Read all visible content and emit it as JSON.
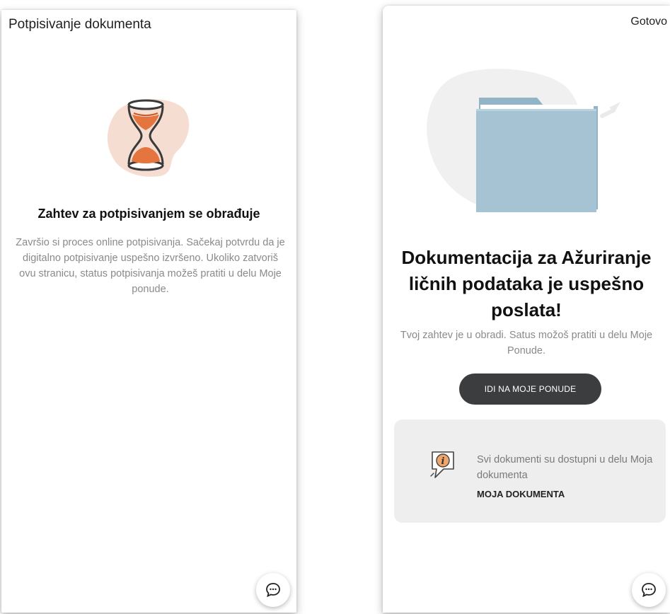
{
  "left_screen": {
    "title": "Potpisivanje dokumenta",
    "heading": "Zahtev za potpisivanjem se obrađuje",
    "body": "Završio si proces online potpisivanja. Sačekaj potvrdu da je digitalno potpisivanje uspešno izvršeno. Ukoliko zatvoriš ovu stranicu, status potpisivanja možeš pratiti u delu Moje ponude.",
    "illustration_icon": "hourglass-icon",
    "chat_icon": "chat-bubble-icon"
  },
  "right_screen": {
    "done_label": "Gotovo",
    "heading": "Dokumentacija za Ažuriranje ličnih podataka je uspešno poslata!",
    "body": "Tvoj zahtev je u obradi. Satus možoš pratiti u delu Moje Ponude.",
    "button_label": "IDI NA MOJE PONUDE",
    "illustration_icon": "folder-icon",
    "info_card": {
      "icon": "info-bubble-icon",
      "text": "Svi dokumenti su dostupni u delu Moja dokumenta",
      "link_label": "MOJA DOKUMENTA"
    },
    "chat_icon": "chat-bubble-icon"
  },
  "colors": {
    "button_bg": "#3c3d3f",
    "accent_orange": "#e4753f",
    "peach_blob": "#f6ddd2",
    "folder_blue": "#a6c3d3",
    "card_bg": "#eeeeee",
    "body_text": "#8a8a8a"
  }
}
